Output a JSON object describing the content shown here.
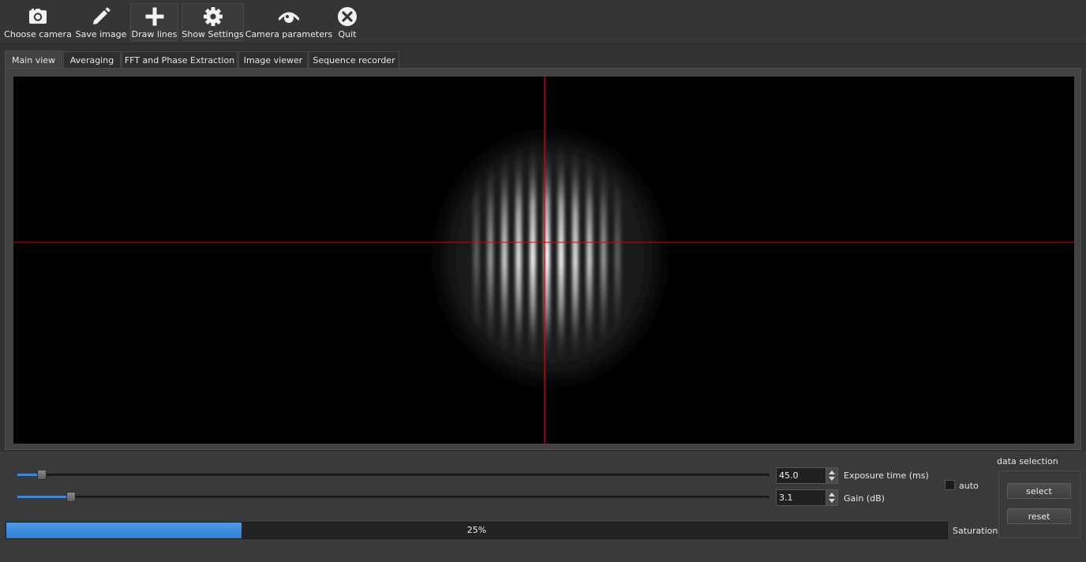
{
  "toolbar": {
    "choose_camera": "Choose camera",
    "save_image": "Save image",
    "draw_lines": "Draw lines",
    "show_settings": "Show Settings",
    "camera_parameters": "Camera parameters",
    "quit": "Quit",
    "icons": [
      "camera-icon",
      "pencil-icon",
      "plus-icon",
      "gear-icon",
      "eye-icon",
      "close-circle-icon"
    ]
  },
  "tabs": [
    {
      "label": "Main view",
      "active": true
    },
    {
      "label": "Averaging",
      "active": false
    },
    {
      "label": "FFT and Phase Extraction",
      "active": false
    },
    {
      "label": "Image viewer",
      "active": false
    },
    {
      "label": "Sequence recorder",
      "active": false
    }
  ],
  "view": {
    "crosshair_color": "#e00000",
    "fringe_count": 11
  },
  "controls": {
    "exposure": {
      "value": "45.0",
      "label": "Exposure time (ms)",
      "slider_fraction": 0.027
    },
    "gain": {
      "value": "3.1",
      "label": "Gain (dB)",
      "slider_fraction": 0.066
    },
    "auto_label": "auto",
    "auto_checked": false,
    "data_selection": {
      "title": "data selection",
      "select": "select",
      "reset": "reset"
    },
    "saturation": {
      "text": "25%",
      "fraction": 0.25,
      "label": "Saturation"
    }
  },
  "colors": {
    "accent": "#3f87d6",
    "background": "#323232",
    "panel": "#424242"
  }
}
